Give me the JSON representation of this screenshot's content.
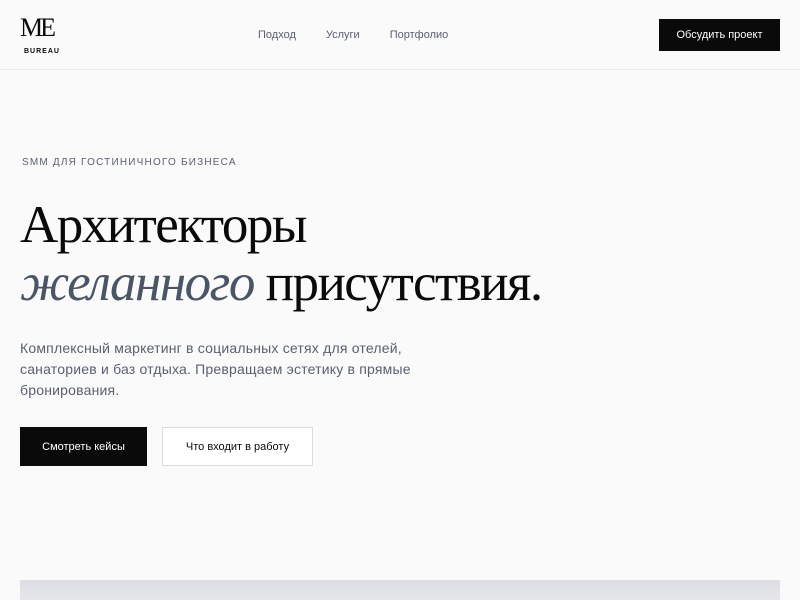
{
  "header": {
    "logo": {
      "mark": "ME",
      "subtitle": "BUREAU"
    },
    "nav": [
      {
        "label": "Подход"
      },
      {
        "label": "Услуги"
      },
      {
        "label": "Портфолио"
      }
    ],
    "cta_label": "Обсудить проект"
  },
  "hero": {
    "eyebrow": "SMM ДЛЯ ГОСТИНИЧНОГО БИЗНЕСА",
    "headline_line1": "Архитекторы",
    "headline_italic": "желанного",
    "headline_rest": " присутствия.",
    "lead": "Комплексный маркетинг в социальных сетях для отелей, санаториев и баз отдыха. Превращаем эстетику в прямые бронирования.",
    "primary_button": "Смотреть кейсы",
    "secondary_button": "Что входит в работу"
  },
  "colors": {
    "background": "#fafafa",
    "text": "#0a0a0a",
    "muted": "#5b6070",
    "accent_italic": "#4a5566"
  }
}
